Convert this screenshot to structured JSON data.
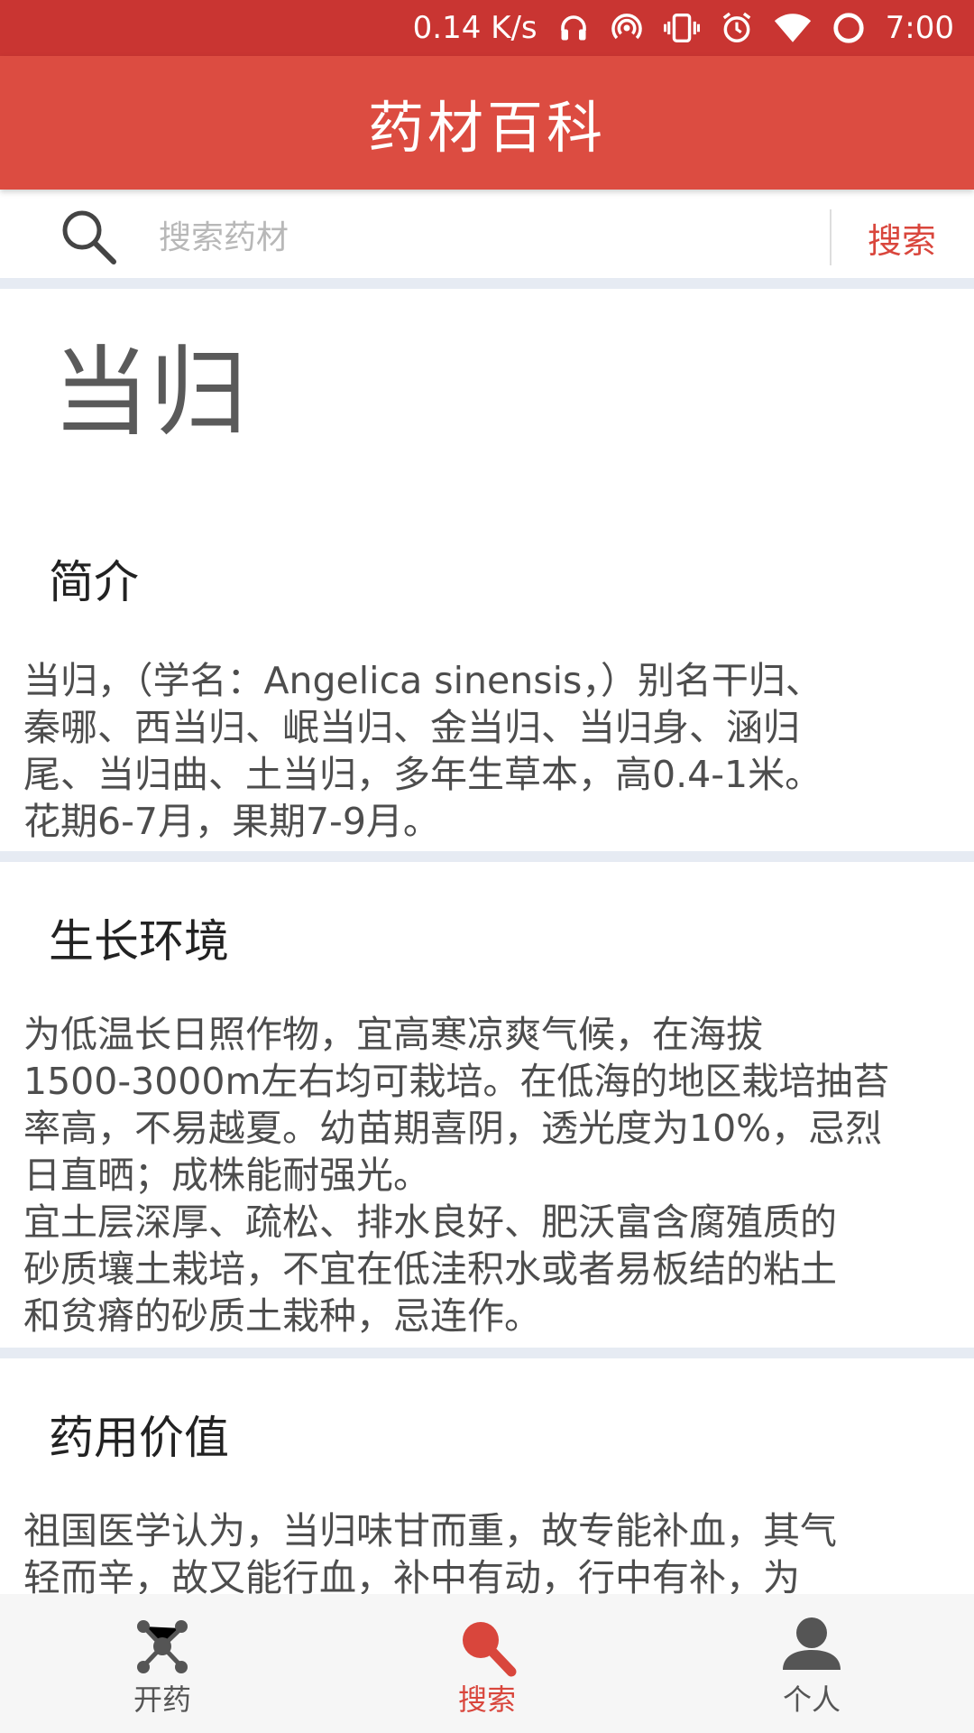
{
  "status_bar": {
    "network_speed": "0.14 K/s",
    "time": "7:00",
    "icons": [
      "headphones-icon",
      "hotspot-icon",
      "vibrate-icon",
      "alarm-icon",
      "wifi-icon",
      "data-saver-icon"
    ]
  },
  "app_bar": {
    "title": "药材百科"
  },
  "search": {
    "placeholder": "搜索药材",
    "value": "",
    "button_label": "搜索",
    "icon": "search-icon"
  },
  "herb": {
    "name": "当归",
    "sections": [
      {
        "title": "简介",
        "body": "当归，（学名：Angelica sinensis，）别名干归、\n秦哪、西当归、岷当归、金当归、当归身、涵归\n尾、当归曲、土当归，多年生草本，高0.4-1米。\n花期6-7月，果期7-9月。"
      },
      {
        "title": "生长环境",
        "body": "为低温长日照作物，宜高寒凉爽气候，在海拔\n1500-3000m左右均可栽培。在低海的地区栽培抽苔\n率高，不易越夏。幼苗期喜阴，透光度为10%，忌烈\n日直晒；成株能耐强光。\n宜土层深厚、疏松、排水良好、肥沃富含腐殖质的\n砂质壤土栽培，不宜在低洼积水或者易板结的粘土\n和贫瘠的砂质土栽种，忌连作。"
      },
      {
        "title": "药用价值",
        "body": "祖国医学认为，当归味甘而重，故专能补血，其气\n轻而辛，故又能行血，补中有动，行中有补，为"
      }
    ]
  },
  "bottom_nav": {
    "items": [
      {
        "label": "开药",
        "icon": "molecule-icon",
        "active": false
      },
      {
        "label": "搜索",
        "icon": "search-icon",
        "active": true
      },
      {
        "label": "个人",
        "icon": "person-icon",
        "active": false
      }
    ]
  },
  "colors": {
    "status_bar": "#c93532",
    "app_bar": "#dc4c41",
    "accent": "#d9463c",
    "separator": "#e6ebf3",
    "nav_background": "#f6f6f6"
  }
}
